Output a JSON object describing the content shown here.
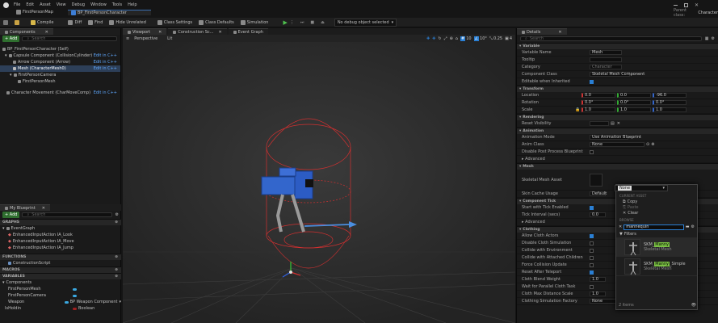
{
  "menu": [
    "File",
    "Edit",
    "Asset",
    "View",
    "Debug",
    "Window",
    "Tools",
    "Help"
  ],
  "project_tab": "FirstPersonMap",
  "asset_tab": "BP_FirstPersonCharacter",
  "parent_class_label": "Parent class:",
  "parent_class_value": "Character",
  "toolbar": {
    "compile": "Compile",
    "diff": "Diff",
    "find": "Find",
    "hide_unrelated": "Hide Unrelated",
    "class_settings": "Class Settings",
    "class_defaults": "Class Defaults",
    "simulation": "Simulation",
    "debug_object": "No debug object selected"
  },
  "components": {
    "tab": "Components",
    "add": "+ Add",
    "search_placeholder": "Search",
    "items": [
      {
        "label": "BP_FirstPersonCharacter (Self)",
        "edit": ""
      },
      {
        "label": "Capsule Component (CollisionCylinder)",
        "edit": "Edit in C++"
      },
      {
        "label": "Arrow Component (Arrow)",
        "edit": "Edit in C++"
      },
      {
        "label": "Mesh (CharacterMesh0)",
        "edit": "Edit in C++"
      },
      {
        "label": "FirstPersonCamera",
        "edit": ""
      },
      {
        "label": "FirstPersonMesh",
        "edit": ""
      },
      {
        "label": "Character Movement (CharMoveComp)",
        "edit": "Edit in C++"
      }
    ]
  },
  "mybp": {
    "tab": "My Blueprint",
    "add": "+ Add",
    "search_placeholder": "Search",
    "graphs_hdr": "GRAPHS",
    "event_graph": "EventGraph",
    "events": [
      "EnhancedInputAction IA_Look",
      "EnhancedInputAction IA_Move",
      "EnhancedInputAction IA_Jump"
    ],
    "functions_hdr": "FUNCTIONS",
    "construction": "ConstructionScript",
    "macros_hdr": "MACROS",
    "variables_hdr": "VARIABLES",
    "components_cat": "Components",
    "vars": [
      {
        "name": "FirstPersonMesh",
        "type": ""
      },
      {
        "name": "FirstPersonCamera",
        "type": ""
      },
      {
        "name": "Weapon",
        "type": "BP Weapon Component"
      },
      {
        "name": "IsHoldin",
        "type": "Boolean"
      }
    ]
  },
  "viewport": {
    "tab1": "Viewport",
    "tab2": "Construction Sc...",
    "tab3": "Event Graph",
    "perspective": "Perspective",
    "lit": "Lit",
    "grid1": "10",
    "grid2": "10°",
    "grid3": "0.25",
    "grid4": "4"
  },
  "details": {
    "tab": "Details",
    "search_placeholder": "Search",
    "sections": {
      "variable": "Variable",
      "transform": "Transform",
      "rendering": "Rendering",
      "animation": "Animation",
      "mesh": "Mesh",
      "component_tick": "Component Tick",
      "clothing": "Clothing"
    },
    "var_rows": [
      {
        "label": "Variable Name",
        "value": "Mesh"
      },
      {
        "label": "Tooltip",
        "value": ""
      },
      {
        "label": "Category",
        "value": "Character"
      },
      {
        "label": "Component Class",
        "value": "Skeletal Mesh Component"
      },
      {
        "label": "Editable when Inherited",
        "value": ""
      }
    ],
    "transform_rows": [
      {
        "label": "Location",
        "x": "0.0",
        "y": "0.0",
        "z": "-96.0"
      },
      {
        "label": "Rotation",
        "x": "0.0°",
        "y": "0.0°",
        "z": "0.0°"
      },
      {
        "label": "Scale",
        "x": "1.0",
        "y": "1.0",
        "z": "1.0"
      }
    ],
    "render_rows": [
      {
        "label": "Reset Visibility",
        "value": ""
      }
    ],
    "anim_rows": [
      {
        "label": "Animation Mode",
        "value": "Use Animation Blueprint"
      },
      {
        "label": "Anim Class",
        "value": "None"
      },
      {
        "label": "Disable Post Process Blueprint",
        "value": ""
      },
      {
        "label": "Advanced",
        "value": ""
      }
    ],
    "mesh_rows": [
      {
        "label": "Skeletal Mesh Asset",
        "value": "None"
      },
      {
        "label": "Skin Cache Usage",
        "value": "Default"
      }
    ],
    "tick_rows": [
      {
        "label": "Start with Tick Enabled",
        "value": ""
      },
      {
        "label": "Tick Interval (secs)",
        "value": "0.0"
      },
      {
        "label": "Advanced",
        "value": ""
      }
    ],
    "cloth_rows": [
      {
        "label": "Allow Cloth Actors",
        "value": ""
      },
      {
        "label": "Disable Cloth Simulation",
        "value": ""
      },
      {
        "label": "Collide with Environment",
        "value": ""
      },
      {
        "label": "Collide with Attached Children",
        "value": ""
      },
      {
        "label": "Force Collision Update",
        "value": ""
      },
      {
        "label": "Reset After Teleport",
        "value": ""
      },
      {
        "label": "Cloth Blend Weight",
        "value": "1.0"
      },
      {
        "label": "Wait for Parallel Cloth Task",
        "value": ""
      },
      {
        "label": "Cloth Max Distance Scale",
        "value": "1.0"
      },
      {
        "label": "Clothing Simulation Factory",
        "value": "None"
      }
    ]
  },
  "dropdown": {
    "header": "None",
    "current_label": "CURRENT ASSET",
    "items": [
      "Copy",
      "Paste",
      "Clear"
    ],
    "browse_label": "BROWSE",
    "search_value": "mannequin",
    "filter": "Filters",
    "assets": [
      {
        "prefix": "SKM_",
        "hl": "Manny",
        "suffix": "",
        "type": "Skeletal Mesh"
      },
      {
        "prefix": "SKM_",
        "hl": "Manny",
        "suffix": "_Simple",
        "type": "Skeletal Mesh"
      }
    ],
    "count": "2 items"
  }
}
